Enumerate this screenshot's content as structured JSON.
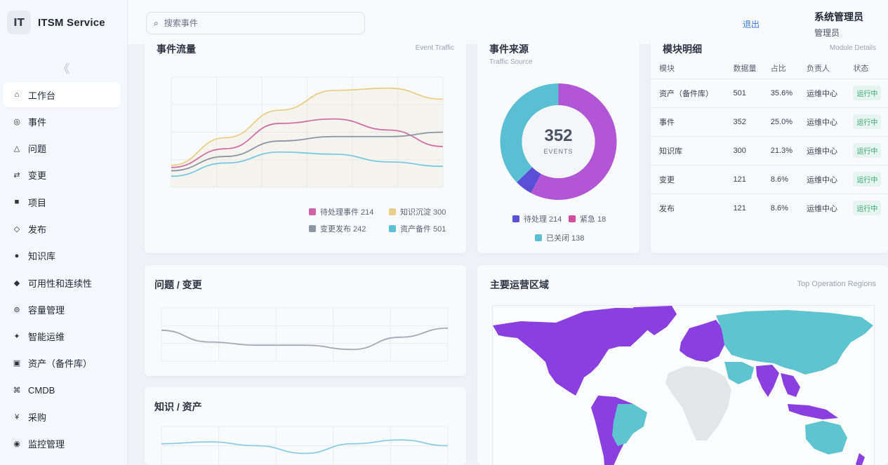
{
  "app": {
    "title": "ITSM Service",
    "logo_text": "IT",
    "collapse_icon": "《"
  },
  "sidebar": {
    "items": [
      {
        "icon": "⌂",
        "label": "工作台",
        "active": true
      },
      {
        "icon": "◎",
        "label": "事件"
      },
      {
        "icon": "△",
        "label": "问题"
      },
      {
        "icon": "⇄",
        "label": "变更"
      },
      {
        "icon": "■",
        "label": "项目"
      },
      {
        "icon": "◇",
        "label": "发布"
      },
      {
        "icon": "●",
        "label": "知识库"
      },
      {
        "icon": "◆",
        "label": "可用性和连续性"
      },
      {
        "icon": "⊚",
        "label": "容量管理"
      },
      {
        "icon": "✦",
        "label": "智能运维"
      },
      {
        "icon": "▣",
        "label": "资产（备件库）"
      },
      {
        "icon": "⌘",
        "label": "CMDB"
      },
      {
        "icon": "¥",
        "label": "采购"
      },
      {
        "icon": "◉",
        "label": "监控管理"
      }
    ]
  },
  "header": {
    "search_placeholder": "搜索事件",
    "user_name": "系统管理员",
    "user_role": "管理员",
    "logout_label": "退出"
  },
  "event_traffic": {
    "title": "事件流量",
    "subtitle": "Event Traffic",
    "legend": [
      {
        "label": "待处理事件 214",
        "color": "#d062a8"
      },
      {
        "label": "知识沉淀 300",
        "color": "#e9cf8a"
      },
      {
        "label": "变更发布 242",
        "color": "#8d96a3"
      },
      {
        "label": "资产备件 501",
        "color": "#5bc0d3"
      }
    ]
  },
  "traffic_source": {
    "title": "事件来源",
    "subtitle": "Traffic Source",
    "center_value": "352",
    "center_label": "EVENTS",
    "legend": [
      {
        "label": "待处理 214",
        "color": "#5a4fd6"
      },
      {
        "label": "紧急 18",
        "color": "#d14f9b"
      },
      {
        "label": "已关闭 138",
        "color": "#5bbfd3"
      }
    ]
  },
  "module_details": {
    "title": "模块明细",
    "subtitle": "Module Details",
    "columns": [
      "模块",
      "数据量",
      "占比",
      "负责人",
      "状态"
    ],
    "rows": [
      [
        "资产（备件库）",
        "501",
        "35.6%",
        "运维中心",
        "运行中"
      ],
      [
        "事件",
        "352",
        "25.0%",
        "运维中心",
        "运行中"
      ],
      [
        "知识库",
        "300",
        "21.3%",
        "运维中心",
        "运行中"
      ],
      [
        "变更",
        "121",
        "8.6%",
        "运维中心",
        "运行中"
      ],
      [
        "发布",
        "121",
        "8.6%",
        "运维中心",
        "运行中"
      ]
    ]
  },
  "problem_change": {
    "title": "问题 / 变更"
  },
  "knowledge_asset": {
    "title": "知识 / 资产"
  },
  "regions": {
    "title": "主要运营区域",
    "subtitle": "Top Operation Regions"
  },
  "colors": {
    "purple": "#8a3fe0",
    "teal": "#5ec4cf",
    "grey_land": "#e4e7ea",
    "badge_green": "#3aa57d"
  },
  "chart_data": [
    {
      "type": "line",
      "title": "事件流量",
      "series": [
        {
          "name": "待处理事件",
          "values": [
            0.18,
            0.35,
            0.58,
            0.62,
            0.52,
            0.37
          ],
          "color": "#d062a8"
        },
        {
          "name": "知识沉淀",
          "values": [
            0.2,
            0.45,
            0.7,
            0.88,
            0.9,
            0.8
          ],
          "color": "#e9cf8a"
        },
        {
          "name": "变更发布",
          "values": [
            0.15,
            0.28,
            0.42,
            0.46,
            0.46,
            0.5
          ],
          "color": "#8d96a3"
        },
        {
          "name": "资产备件",
          "values": [
            0.1,
            0.22,
            0.32,
            0.3,
            0.23,
            0.19
          ],
          "color": "#7cc8e2"
        }
      ]
    },
    {
      "type": "pie",
      "title": "事件来源",
      "slices": [
        {
          "label": "待处理",
          "value": 214,
          "color": "#b157d6"
        },
        {
          "label": "紧急",
          "value": 18,
          "color": "#5a4fd6"
        },
        {
          "label": "已关闭",
          "value": 138,
          "color": "#5bbfd3"
        }
      ]
    },
    {
      "type": "line",
      "title": "问题 / 变更",
      "series": [
        {
          "values": [
            0.58,
            0.36,
            0.3,
            0.3,
            0.22,
            0.45,
            0.62
          ],
          "color": "#a3aab5"
        }
      ]
    },
    {
      "type": "line",
      "title": "知识 / 资产",
      "series": [
        {
          "values": [
            0.55,
            0.6,
            0.5,
            0.3,
            0.55,
            0.65,
            0.5
          ],
          "color": "#8ccde6"
        }
      ]
    }
  ]
}
